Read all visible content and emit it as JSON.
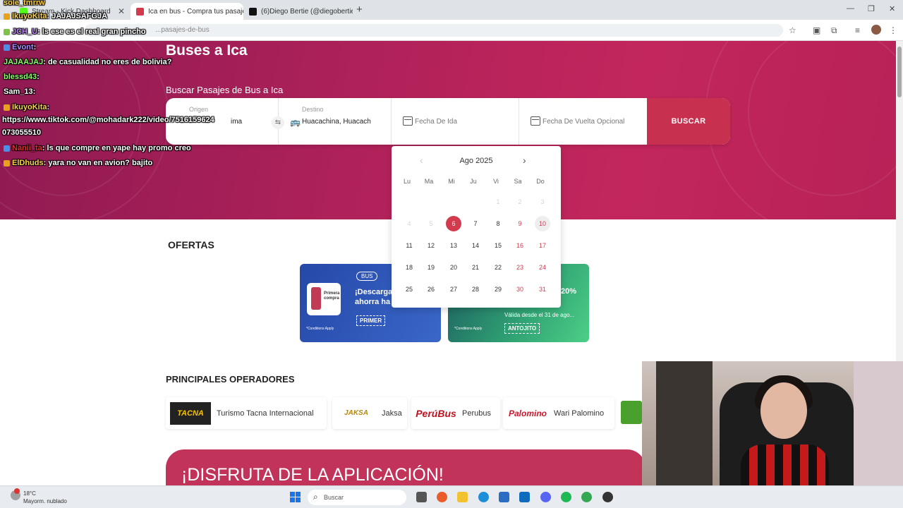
{
  "browser": {
    "tabs": [
      {
        "label": "Stream - Kick Dashboard",
        "fav": "#53fc18"
      },
      {
        "label": "Ica en bus - Compra tus pasaje",
        "fav": "#d23b4d"
      },
      {
        "label": "(6)Diego Bertie (@diegobertie",
        "fav": "#111111"
      }
    ],
    "url": "...pasajes-de-bus"
  },
  "hero": {
    "title": "Buses a Ica",
    "subtitle": "Buscar Pasajes de Bus a Ica"
  },
  "search": {
    "origin_label": "Origen",
    "origin_value": "ima",
    "dest_label": "Destino",
    "dest_value": "Huacachina, Huacach",
    "date_placeholder": "Fecha De Ida",
    "return_placeholder": "Fecha De Vuelta Opcional",
    "button": "BUSCAR"
  },
  "calendar": {
    "month": "Ago 2025",
    "weekdays": [
      "Lu",
      "Ma",
      "Mi",
      "Ju",
      "Vi",
      "Sa",
      "Do"
    ],
    "selected": 6,
    "hovered": 10
  },
  "ofertas": {
    "title": "OFERTAS",
    "promo1": {
      "badge": "BUS",
      "text": [
        "¡Descarga",
        "ahorra ha"
      ],
      "cond": "*Conditions Apply",
      "code": "PRIMER",
      "img_text": [
        "Primera",
        "compra"
      ]
    },
    "promo2": {
      "pct": "20%",
      "valid": "Válida desde el 31 de ago...",
      "cond": "*Conditions Apply",
      "code": "ANTOJITO"
    }
  },
  "operadores": {
    "title": "PRINCIPALES OPERADORES",
    "items": [
      {
        "name": "Turismo Tacna Internacional",
        "logo": "TACNA"
      },
      {
        "name": "Jaksa",
        "logo": "JAKSA"
      },
      {
        "name": "Perubus",
        "logo": "PerúBus"
      },
      {
        "name": "Wari Palomino",
        "logo": "Palomino"
      }
    ]
  },
  "app_banner": "¡DISFRUTA DE LA APLICACIÓN!",
  "chat": [
    {
      "user": "sole_tmrrw",
      "msg": ""
    },
    {
      "user": "IkuyoKita",
      "msg": ": JAJAJSAFGJA"
    },
    {
      "user": "JCH_U",
      "msg": ": ls ese es el real gran pincho"
    },
    {
      "user": "Evont",
      "msg": ":"
    },
    {
      "user": "JAJAAJAJ",
      "msg": ": de casualidad no eres de bolivia?"
    },
    {
      "user": "blessd43",
      "msg": ":"
    },
    {
      "user": "Sam_13",
      "msg": ":"
    },
    {
      "user": "IkuyoKita",
      "msg": ":"
    },
    {
      "user": "",
      "msg": "https://www.tiktok.com/@mohadark222/video/7516159624"
    },
    {
      "user": "",
      "msg": "073055510"
    },
    {
      "user": "Nanii_ta",
      "msg": ": ls que compre en yape hay promo creo"
    },
    {
      "user": "ElDhuds",
      "msg": ": yara no van en avion? bajito"
    }
  ],
  "taskbar": {
    "temp": "18°C",
    "weather": "Mayorm. nublado",
    "search": "Buscar"
  }
}
